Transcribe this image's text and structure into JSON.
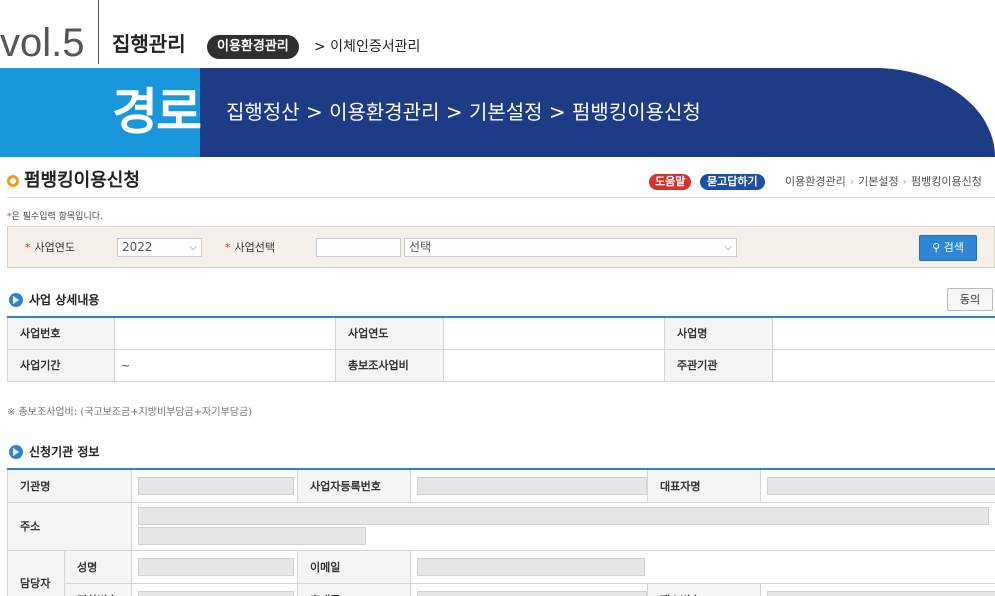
{
  "header": {
    "vol": "vol.5",
    "chapter": "집행관리",
    "chip": "이용환경관리",
    "sub": "> 이체인증서관리"
  },
  "banner": {
    "title": "경로",
    "path": "집행정산 > 이용환경관리 > 기본설정 > 펌뱅킹이용신청"
  },
  "page": {
    "title": "펌뱅킹이용신청",
    "help": "도움말",
    "qa": "묻고답하기",
    "crumbs": [
      "이용환경관리",
      "기본설정",
      "펌뱅킹이용신청"
    ],
    "required_note_star": "*",
    "required_note": "은 필수입력 항목입니다."
  },
  "search": {
    "year_label": "사업연도",
    "year_value": "2022",
    "biz_label": "사업선택",
    "biz_select": "선택",
    "button": "검색"
  },
  "detail": {
    "title": "사업 상세내용",
    "agree": "동의",
    "rows": [
      [
        {
          "h": "사업번호",
          "v": ""
        },
        {
          "h": "사업연도",
          "v": ""
        },
        {
          "h": "사업명",
          "v": ""
        }
      ],
      [
        {
          "h": "사업기간",
          "v": "~"
        },
        {
          "h": "총보조사업비",
          "v": ""
        },
        {
          "h": "주관기관",
          "v": ""
        }
      ]
    ],
    "note": "※ 총보조사업비: (국고보조금+지방비부담금+자기부담금)"
  },
  "org": {
    "title": "신청기관 정보",
    "l_org": "기관명",
    "l_bizno": "사업자등록번호",
    "l_ceo": "대표자명",
    "l_addr": "주소",
    "l_manager": "담당자",
    "l_name": "성명",
    "l_email": "이메일",
    "l_phone": "전화번호",
    "l_mobile": "휴대폰",
    "l_fax": "팩스번호"
  }
}
